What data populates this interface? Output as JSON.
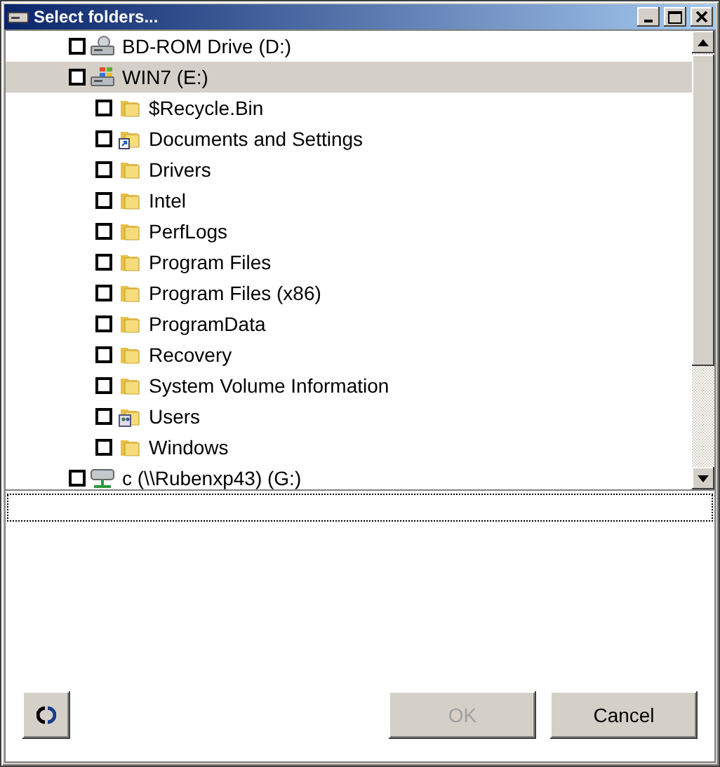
{
  "window": {
    "title": "Select folders..."
  },
  "tree": {
    "items": [
      {
        "label": "BD-ROM Drive (D:)",
        "kind": "optical",
        "checked": false,
        "selected": false
      },
      {
        "label": "WIN7 (E:)",
        "kind": "windows",
        "checked": false,
        "selected": true,
        "children": [
          {
            "label": "$Recycle.Bin",
            "kind": "folder",
            "checked": false,
            "selected": false
          },
          {
            "label": "Documents and Settings",
            "kind": "shortcut",
            "checked": false,
            "selected": false
          },
          {
            "label": "Drivers",
            "kind": "folder",
            "checked": false,
            "selected": false
          },
          {
            "label": "Intel",
            "kind": "folder",
            "checked": false,
            "selected": false
          },
          {
            "label": "PerfLogs",
            "kind": "folder",
            "checked": false,
            "selected": false
          },
          {
            "label": "Program Files",
            "kind": "folder",
            "checked": false,
            "selected": false
          },
          {
            "label": "Program Files (x86)",
            "kind": "folder",
            "checked": false,
            "selected": false
          },
          {
            "label": "ProgramData",
            "kind": "folder",
            "checked": false,
            "selected": false
          },
          {
            "label": "Recovery",
            "kind": "folder",
            "checked": false,
            "selected": false
          },
          {
            "label": "System Volume Information",
            "kind": "folder",
            "checked": false,
            "selected": false
          },
          {
            "label": "Users",
            "kind": "users",
            "checked": false,
            "selected": false
          },
          {
            "label": "Windows",
            "kind": "folder",
            "checked": false,
            "selected": false
          }
        ]
      },
      {
        "label": "c (\\\\Rubenxp43) (G:)",
        "kind": "network",
        "checked": false,
        "selected": false
      }
    ]
  },
  "buttons": [
    {
      "kind": "refresh",
      "disabled": false
    },
    {
      "kind": "text",
      "label": "OK",
      "disabled": true
    },
    {
      "kind": "text",
      "label": "Cancel",
      "disabled": false
    }
  ]
}
